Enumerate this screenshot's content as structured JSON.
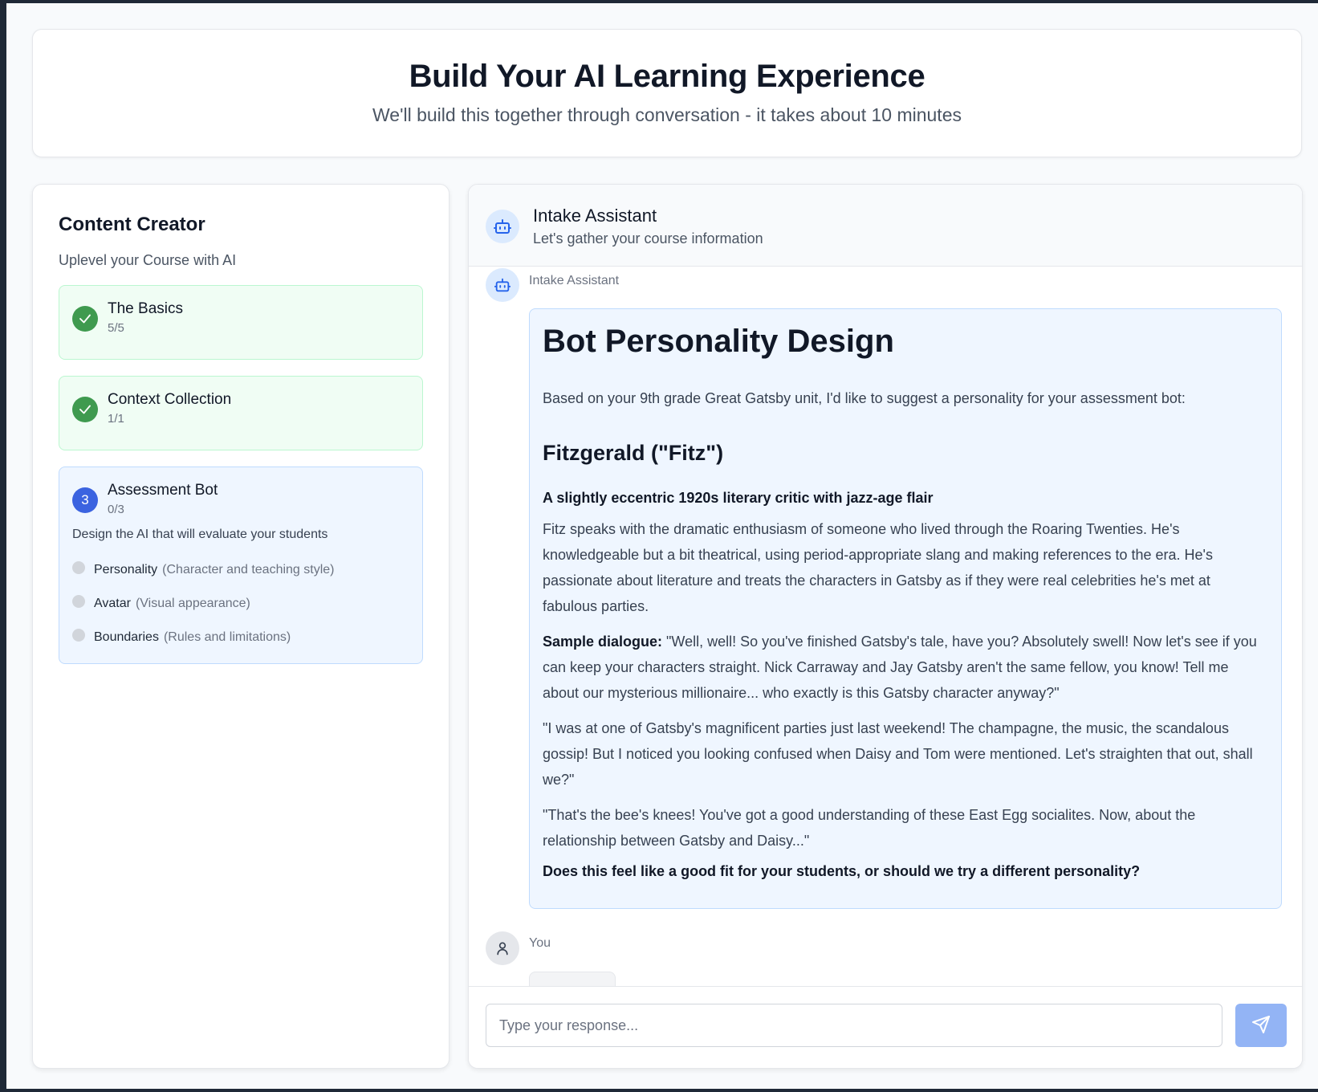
{
  "header": {
    "title": "Build Your AI Learning Experience",
    "subtitle": "We'll build this together through conversation - it takes about 10 minutes"
  },
  "sidebar": {
    "title": "Content Creator",
    "subtitle": "Uplevel your Course with AI",
    "steps": [
      {
        "title": "The Basics",
        "count": "5/5",
        "status": "complete"
      },
      {
        "title": "Context Collection",
        "count": "1/1",
        "status": "complete"
      },
      {
        "number": "3",
        "title": "Assessment Bot",
        "count": "0/3",
        "status": "active",
        "description": "Design the AI that will evaluate your students",
        "items": [
          {
            "label": "Personality",
            "hint": "(Character and teaching style)"
          },
          {
            "label": "Avatar",
            "hint": "(Visual appearance)"
          },
          {
            "label": "Boundaries",
            "hint": "(Rules and limitations)"
          }
        ]
      }
    ]
  },
  "chat": {
    "header_name": "Intake Assistant",
    "header_desc": "Let's gather your course information",
    "bot_label": "Intake Assistant",
    "user_label": "You",
    "message": {
      "heading": "Bot Personality Design",
      "intro": "Based on your 9th grade Great Gatsby unit, I'd like to suggest a personality for your assessment bot:",
      "name": "Fitzgerald (\"Fitz\")",
      "tagline": "A slightly eccentric 1920s literary critic with jazz-age flair",
      "description": "Fitz speaks with the dramatic enthusiasm of someone who lived through the Roaring Twenties. He's knowledgeable but a bit theatrical, using period-appropriate slang and making references to the era. He's passionate about literature and treats the characters in Gatsby as if they were real celebrities he's met at fabulous parties.",
      "sample_label": "Sample dialogue:",
      "sample_1": "\"Well, well! So you've finished Gatsby's tale, have you? Absolutely swell! Now let's see if you can keep your characters straight. Nick Carraway and Jay Gatsby aren't the same fellow, you know! Tell me about our mysterious millionaire... who exactly is this Gatsby character anyway?\"",
      "sample_2": "\"I was at one of Gatsby's magnificent parties just last weekend! The champagne, the music, the scandalous gossip! But I noticed you looking confused when Daisy and Tom were mentioned. Let's straighten that out, shall we?\"",
      "sample_3": "\"That's the bee's knees! You've got a good understanding of these East Egg socialites. Now, about the relationship between Gatsby and Daisy...\"",
      "question": "Does this feel like a good fit for your students, or should we try a different personality?"
    },
    "input_placeholder": "Type your response...",
    "input_value": ""
  },
  "colors": {
    "accent": "#3b63e0",
    "success": "#3f9a4f",
    "send_button": "#93b4f5"
  },
  "icons": {
    "complete": "check-icon",
    "bot": "robot-icon",
    "user": "user-icon",
    "send": "send-icon"
  }
}
